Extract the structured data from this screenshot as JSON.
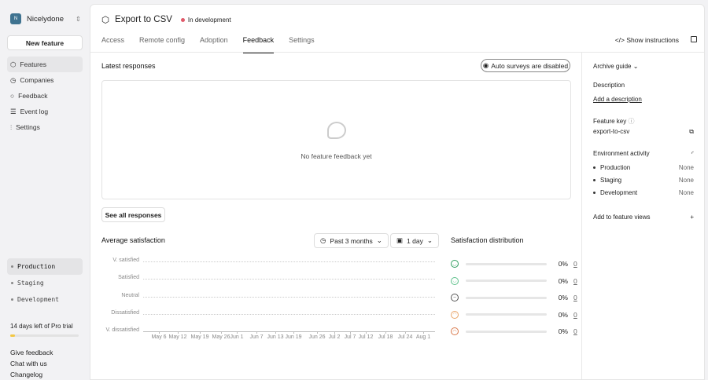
{
  "sidebar": {
    "org": {
      "initial": "N",
      "name": "Nicelydone"
    },
    "new_feature": "New feature",
    "nav": [
      {
        "label": "Features",
        "icon": "cube-icon"
      },
      {
        "label": "Companies",
        "icon": "clock-icon"
      },
      {
        "label": "Feedback",
        "icon": "chat-icon"
      },
      {
        "label": "Event log",
        "icon": "list-icon"
      },
      {
        "label": "Settings",
        "icon": "sliders-icon"
      }
    ],
    "environments": [
      "Production",
      "Staging",
      "Development"
    ],
    "trial": {
      "text": "14 days left of Pro trial",
      "progress_percent": 7
    },
    "links": [
      "Give feedback",
      "Chat with us",
      "Changelog"
    ]
  },
  "header": {
    "title": "Export to CSV",
    "status": "In development",
    "status_color": "#e05a6a",
    "tabs": [
      "Access",
      "Remote config",
      "Adoption",
      "Feedback",
      "Settings"
    ],
    "active_tab": "Feedback",
    "show_instructions": "Show instructions"
  },
  "latest": {
    "title": "Latest responses",
    "auto_surveys": "Auto surveys are disabled",
    "empty": "No feature feedback yet",
    "see_all": "See all responses"
  },
  "avg": {
    "title": "Average satisfaction",
    "range": "Past 3 months",
    "interval": "1 day",
    "chart_data": {
      "type": "line",
      "series": [],
      "y_categories": [
        "V. satisfied",
        "Satisfied",
        "Neutral",
        "Dissatisfied",
        "V. dissatisfied"
      ],
      "x_ticks": [
        "May 6",
        "May 12",
        "May 19",
        "May 26",
        "Jun 1",
        "Jun 7",
        "Jun 13",
        "Jun 19",
        "Jun 26",
        "Jul 2",
        "Jul 7",
        "Jul 12",
        "Jul 18",
        "Jul 24",
        "Aug 1"
      ],
      "grid": true
    }
  },
  "distribution": {
    "title": "Satisfaction distribution",
    "rows": [
      {
        "icon": "very-satisfied-face-icon",
        "color": "#2e9e5e",
        "pct": "0%",
        "count": "0"
      },
      {
        "icon": "satisfied-face-icon",
        "color": "#5cc08a",
        "pct": "0%",
        "count": "0"
      },
      {
        "icon": "neutral-face-icon",
        "color": "#555555",
        "pct": "0%",
        "count": "0"
      },
      {
        "icon": "dissatisfied-face-icon",
        "color": "#e9a66a",
        "pct": "0%",
        "count": "0"
      },
      {
        "icon": "very-dissatisfied-face-icon",
        "color": "#d9784a",
        "pct": "0%",
        "count": "0"
      }
    ]
  },
  "right": {
    "archive": "Archive guide",
    "description_label": "Description",
    "add_description": "Add a description",
    "key_label": "Feature key",
    "key": "export-to-csv",
    "env_activity": "Environment activity",
    "envs": [
      {
        "name": "Production",
        "value": "None"
      },
      {
        "name": "Staging",
        "value": "None"
      },
      {
        "name": "Development",
        "value": "None"
      }
    ],
    "add_views": "Add to feature views"
  }
}
